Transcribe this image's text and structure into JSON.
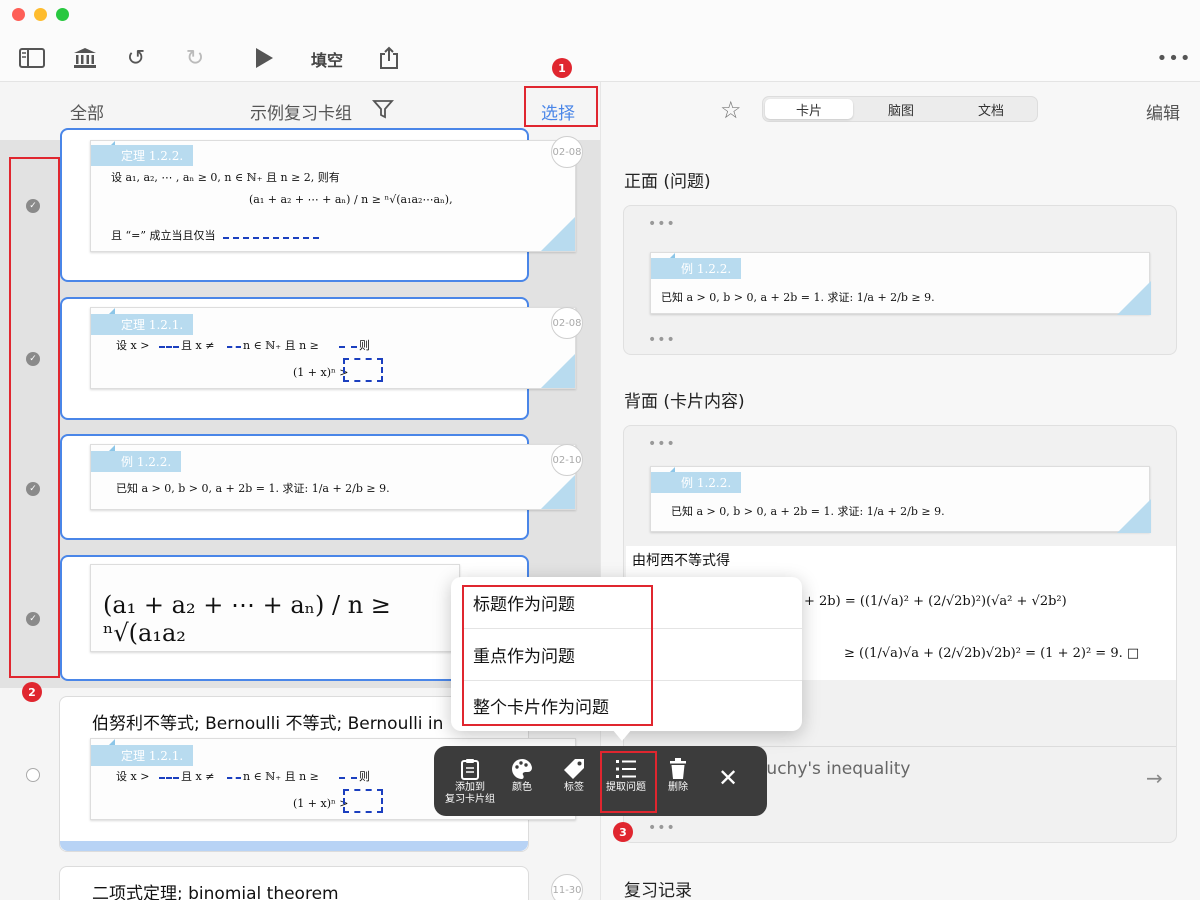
{
  "toolbar": {
    "fill_blank_label": "填空",
    "icons": [
      "sidebar-icon",
      "library-icon",
      "undo-icon",
      "redo-icon",
      "play-icon",
      "share-icon",
      "more-icon"
    ]
  },
  "left_header": {
    "all_label": "全部",
    "deck_name": "示例复习卡组",
    "select_label": "选择"
  },
  "cards": [
    {
      "tag": "定理 1.2.2.",
      "date": "02-08",
      "line1": "设 a₁, a₂, ⋯ , aₙ ≥ 0, n ∈ ℕ₊ 且 n ≥ 2, 则有",
      "formula": "(a₁ + a₂ + ⋯ + aₙ) / n ≥ ⁿ√(a₁a₂⋯aₙ),",
      "line3": "且 “=” 成立当且仅当"
    },
    {
      "tag": "定理 1.2.1.",
      "date": "02-08",
      "line1": "设 x >",
      "line1b": "且 x ≠",
      "line1c": "n ∈ ℕ₊ 且 n ≥",
      "line1d": "则",
      "formula": "(1 + x)ⁿ >"
    },
    {
      "tag": "例 1.2.2.",
      "date": "02-10",
      "line1": "已知 a > 0, b > 0, a + 2b = 1. 求证: 1/a + 2/b ≥ 9."
    },
    {
      "formula": "(a₁ + a₂ + ⋯ + aₙ) / n ≥ ⁿ√(a₁a₂"
    },
    {
      "title": "伯努利不等式; Bernoulli 不等式; Bernoulli in",
      "tag": "定理 1.2.1.",
      "line1": "设 x >",
      "line1b": "且 x ≠",
      "line1c": "n ∈ ℕ₊ 且 n ≥",
      "line1d": "则",
      "formula": "(1 + x)ⁿ >"
    },
    {
      "title": "二项式定理; binomial theorem",
      "date": "11-30"
    }
  ],
  "right_header": {
    "tabs": [
      "卡片",
      "脑图",
      "文档"
    ],
    "active_tab": "卡片",
    "edit_label": "编辑"
  },
  "front": {
    "title": "正面 (问题)",
    "tag": "例 1.2.2.",
    "text": "已知 a > 0, b > 0, a + 2b = 1. 求证: 1/a + 2/b ≥ 9."
  },
  "back": {
    "title": "背面 (卡片内容)",
    "tag": "例 1.2.2.",
    "text": "已知 a > 0, b > 0, a + 2b = 1. 求证: 1/a + 2/b ≥ 9.",
    "proof_intro": "由柯西不等式得",
    "proof_line1": "+ 2b) = ((1/√a)² + (2/√2b)²)(√a² + √2b²)",
    "proof_line2": "≥ ((1/√a)√a + (2/√2b)√2b)² = (1 + 2)² = 9.  □",
    "related": "柯西不等式; Cauchy's inequality"
  },
  "review_title": "复习记录",
  "menu": {
    "items": [
      "标题作为问题",
      "重点作为问题",
      "整个卡片作为问题"
    ]
  },
  "actions": [
    {
      "label": "添加到\n复习卡片组",
      "icon": "clipboard-icon"
    },
    {
      "label": "颜色",
      "icon": "palette-icon"
    },
    {
      "label": "标签",
      "icon": "tag-icon"
    },
    {
      "label": "提取问题",
      "icon": "list-icon"
    },
    {
      "label": "删除",
      "icon": "trash-icon"
    }
  ],
  "badges": [
    "1",
    "2",
    "3"
  ],
  "colors": {
    "accent": "#4a86e8",
    "highlight": "#e0262f",
    "tag_bg": "#b8dbef",
    "blank": "#1b3fbf"
  }
}
